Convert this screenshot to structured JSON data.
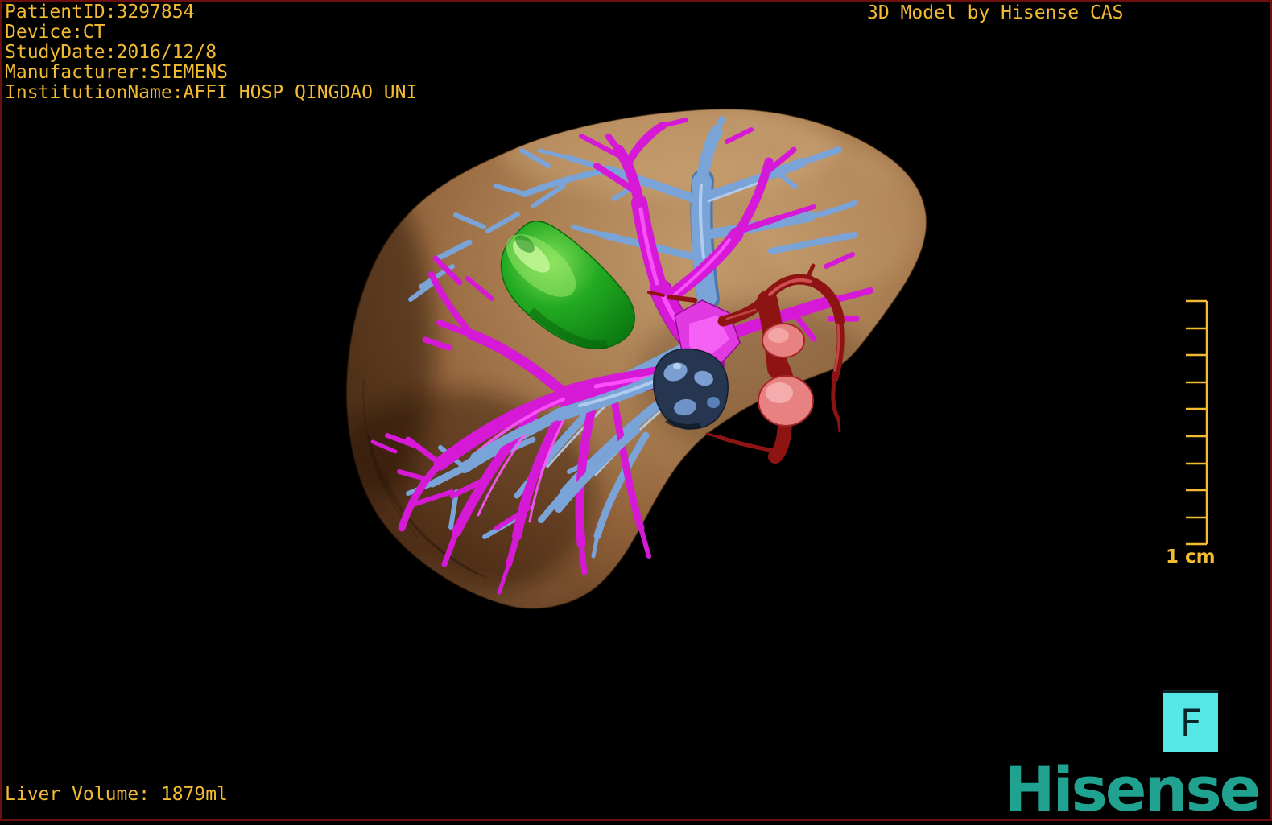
{
  "palette": {
    "background": "#000000",
    "frame_border": "#6e0f0f",
    "annotation_gold": "#f2bb31",
    "liver_tan": "#a87c50",
    "portal_magenta": "#d619d6",
    "hepatic_blue": "#7aa3d8",
    "lesion_green": "#1ea51e",
    "artery_red": "#8e1414",
    "artery_light_red": "#e88282",
    "tumor_navy": "#273650",
    "marker_cyan": "#55e6e6",
    "logo_teal": "#20a290"
  },
  "overlay_top_left": {
    "lines": [
      "PatientID:3297854",
      "Device:CT",
      "StudyDate:2016/12/8",
      "Manufacturer:SIEMENS",
      "InstitutionName:AFFI HOSP QINGDAO UNI"
    ]
  },
  "overlay_top_right": {
    "title": "3D Model by Hisense CAS"
  },
  "overlay_bottom_left": {
    "volume_text": "Liver Volume: 1879ml"
  },
  "scale_bar": {
    "label": "1 cm",
    "ticks": 10
  },
  "orientation_marker": {
    "letter": "F"
  },
  "branding": {
    "logo_text": "Hisense"
  },
  "model": {
    "structures": [
      {
        "name": "liver",
        "color": "#a87c50"
      },
      {
        "name": "portal-vein-tree",
        "color": "#d619d6"
      },
      {
        "name": "hepatic-vein-tree",
        "color": "#7aa3d8"
      },
      {
        "name": "hepatic-artery",
        "color": "#8e1414"
      },
      {
        "name": "artery-aneurysm",
        "color": "#e88282"
      },
      {
        "name": "green-lesion",
        "color": "#1ea51e"
      },
      {
        "name": "dark-blue-lesion",
        "color": "#273650"
      }
    ]
  }
}
